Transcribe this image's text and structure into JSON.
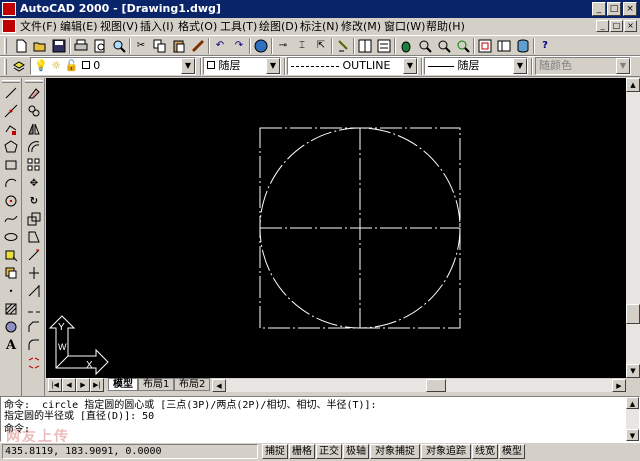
{
  "window": {
    "title": "AutoCAD 2000 - [Drawing1.dwg]",
    "controls": [
      "_",
      "□",
      "×"
    ],
    "doc_controls": [
      "_",
      "□",
      "×"
    ]
  },
  "menu": [
    "文件(F)",
    "编辑(E)",
    "视图(V)",
    "插入(I)",
    "格式(O)",
    "工具(T)",
    "绘图(D)",
    "标注(N)",
    "修改(M)",
    "窗口(W)",
    "帮助(H)"
  ],
  "standard_toolbar": {
    "icons": [
      "new-icon",
      "open-icon",
      "save-icon",
      "print-icon",
      "preview-icon",
      "find-icon",
      "cut-icon",
      "copy-icon",
      "paste-icon",
      "match-properties-icon",
      "undo-icon",
      "redo-icon",
      "browser-icon",
      "snap-from-icon",
      "ucs-icon",
      "tracking-icon",
      "grip-icon",
      "tiled-icon",
      "properties-icon",
      "pan-icon",
      "zoom-realtime-icon",
      "zoom-window-icon",
      "zoom-previous-icon",
      "aerial-view-icon",
      "design-center-icon",
      "db-icon",
      "help-icon"
    ]
  },
  "properties_toolbar": {
    "layer_value": "0",
    "color_value": "随层",
    "linetype_value": "OUTLINE",
    "lineweight_value": "随层",
    "plotstyle_value": "随颜色"
  },
  "draw_toolbar": {
    "icons": [
      "line-icon",
      "construction-line-icon",
      "polyline-icon",
      "polygon-icon",
      "rectangle-icon",
      "arc-icon",
      "circle-icon",
      "spline-icon",
      "ellipse-icon",
      "insert-block-icon",
      "make-block-icon",
      "point-icon",
      "hatch-icon",
      "region-icon",
      "multiline-text-icon"
    ]
  },
  "modify_toolbar": {
    "icons": [
      "erase-icon",
      "copy-object-icon",
      "mirror-icon",
      "offset-icon",
      "array-icon",
      "move-icon",
      "rotate-icon",
      "scale-icon",
      "stretch-icon",
      "lengthen-icon",
      "trim-icon",
      "extend-icon",
      "break-icon",
      "chamfer-icon",
      "fillet-icon",
      "explode-icon"
    ]
  },
  "ucs": {
    "y_label": "Y",
    "w_label": "W",
    "x_label": "X"
  },
  "layout_tabs": [
    "模型",
    "布局1",
    "布局2"
  ],
  "command": {
    "line1": "命令: _circle 指定圆的圆心或 [三点(3P)/两点(2P)/相切、相切、半径(T)]:",
    "line2": "指定圆的半径或 [直径(D)]: 50",
    "line3": "命令:"
  },
  "status": {
    "coords": "435.8119, 183.9091, 0.0000",
    "toggles": [
      "捕捉",
      "栅格",
      "正交",
      "极轴",
      "对象捕捉",
      "对象追踪",
      "线宽",
      "模型"
    ]
  },
  "watermark": "网友上传",
  "colors": {
    "titlebar": "#0a246a",
    "canvas": "#000000",
    "chrome": "#d4d0c8",
    "drawing_lines": "#ffffff"
  }
}
